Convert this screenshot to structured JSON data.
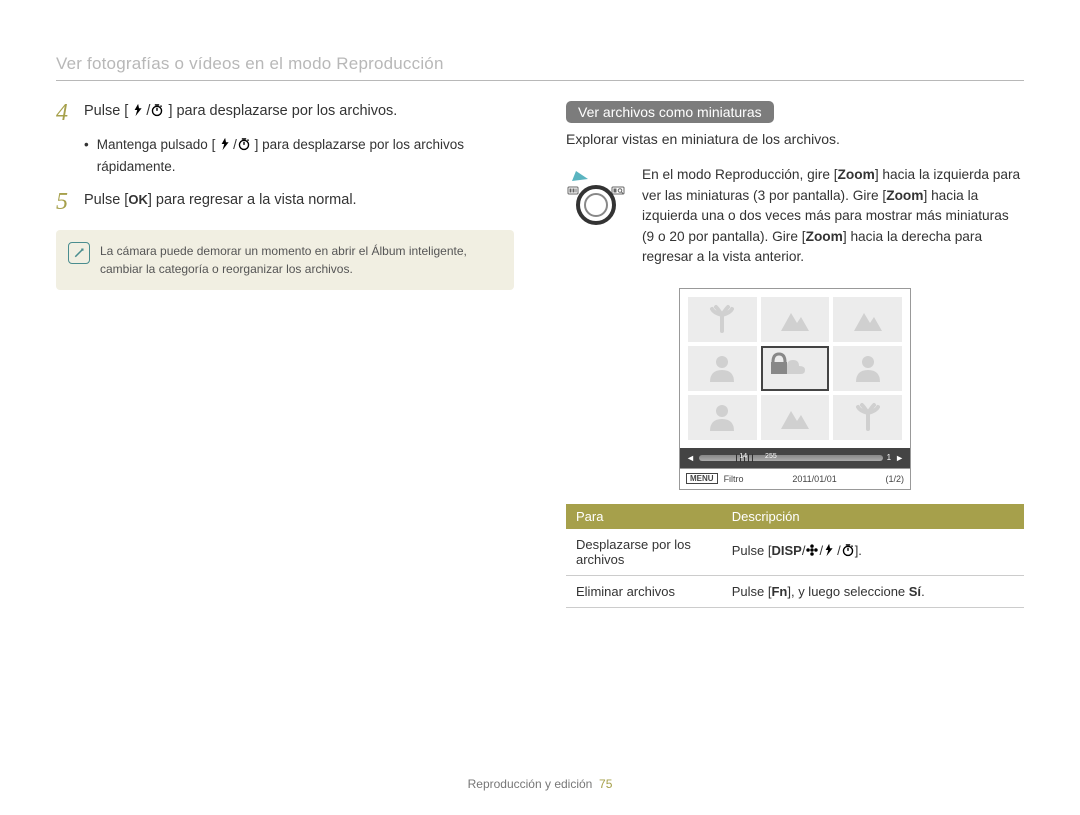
{
  "header": {
    "title": "Ver fotografías o vídeos en el modo Reproducción"
  },
  "left": {
    "step4_num": "4",
    "step4_text_a": "Pulse [",
    "step4_text_b": "] para desplazarse por los archivos.",
    "step4_sub_a": "Mantenga pulsado [",
    "step4_sub_b": "] para desplazarse por los archivos rápidamente.",
    "step5_num": "5",
    "step5_text_a": "Pulse [",
    "step5_text_b": "] para regresar a la vista normal.",
    "ok_label": "OK",
    "note": "La cámara puede demorar un momento en abrir el Álbum inteligente, cambiar la categoría o reorganizar los archivos."
  },
  "right": {
    "pill": "Ver archivos como miniaturas",
    "lead": "Explorar vistas en miniatura de los archivos.",
    "zoom_a": "En el modo Reproducción, gire [",
    "zoom_b": "] hacia la izquierda para ver las miniaturas (3 por pantalla). Gire [",
    "zoom_c": "] hacia la izquierda una o dos veces más para mostrar más miniaturas (9 o 20 por pantalla). Gire [",
    "zoom_d": "] hacia la derecha para regresar a la vista anterior.",
    "zoom_word": "Zoom",
    "screen": {
      "slider_left": "14",
      "slider_right": "255",
      "slider_far_right": "1",
      "menu": "MENU",
      "filtro": "Filtro",
      "date": "2011/01/01",
      "page": "(1/2)"
    },
    "table": {
      "head_para": "Para",
      "head_desc": "Descripción",
      "row1_para": "Desplazarse por los archivos",
      "row1_desc_a": "Pulse [",
      "row1_desc_b": "].",
      "disp": "DISP",
      "row2_para": "Eliminar archivos",
      "row2_desc_a": "Pulse [",
      "row2_desc_b": "], y luego seleccione ",
      "row2_desc_c": ".",
      "fn": "Fn",
      "si": "Sí"
    }
  },
  "footer": {
    "section": "Reproducción y edición",
    "page": "75"
  }
}
